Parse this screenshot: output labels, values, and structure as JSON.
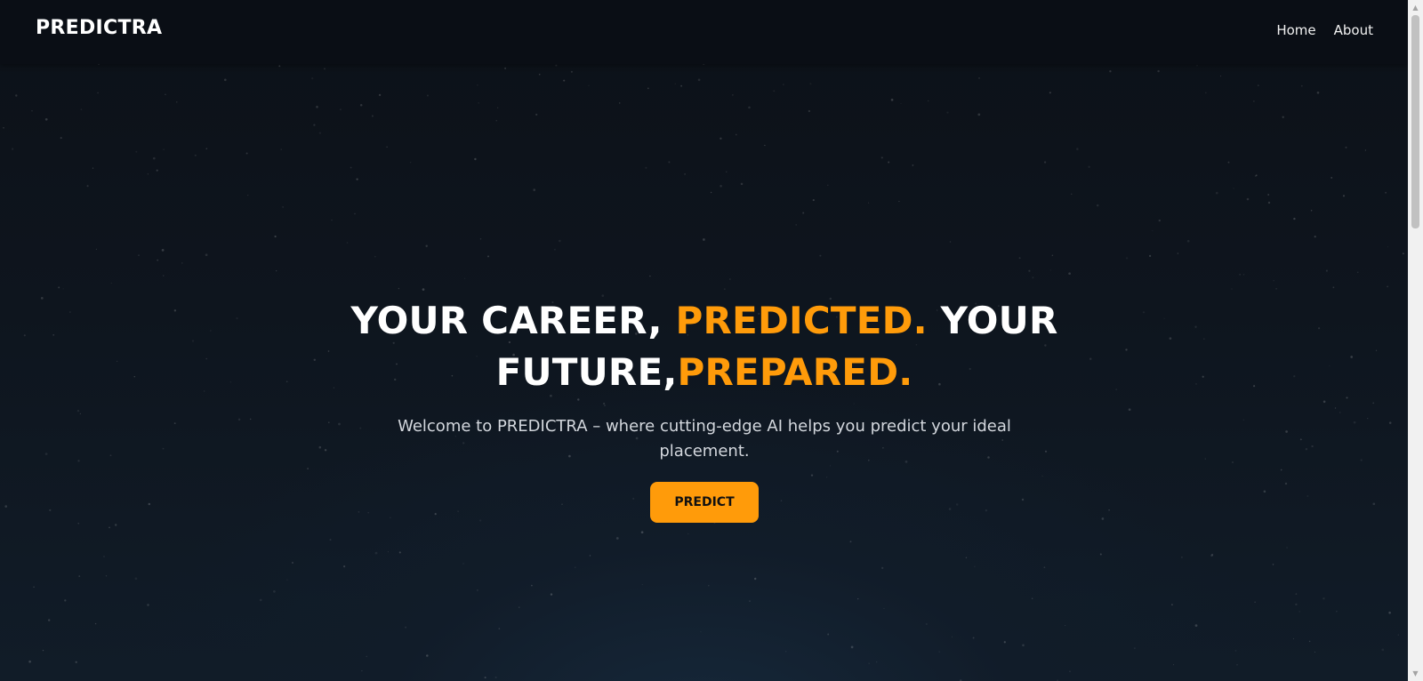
{
  "navbar": {
    "brand": "PREDICTRA",
    "links": [
      {
        "label": "Home"
      },
      {
        "label": "About"
      }
    ]
  },
  "hero": {
    "headline_part1": "YOUR CAREER, ",
    "headline_accent1": "PREDICTED.",
    "headline_part2": " YOUR FUTURE,",
    "headline_accent2": "PREPARED.",
    "subtitle": "Welcome to PREDICTRA – where cutting-edge AI helps you predict your ideal placement.",
    "cta_label": "PREDICT"
  },
  "colors": {
    "accent": "#ff9b0a",
    "background": "#0d141d",
    "navbar": "#0a0e15"
  }
}
